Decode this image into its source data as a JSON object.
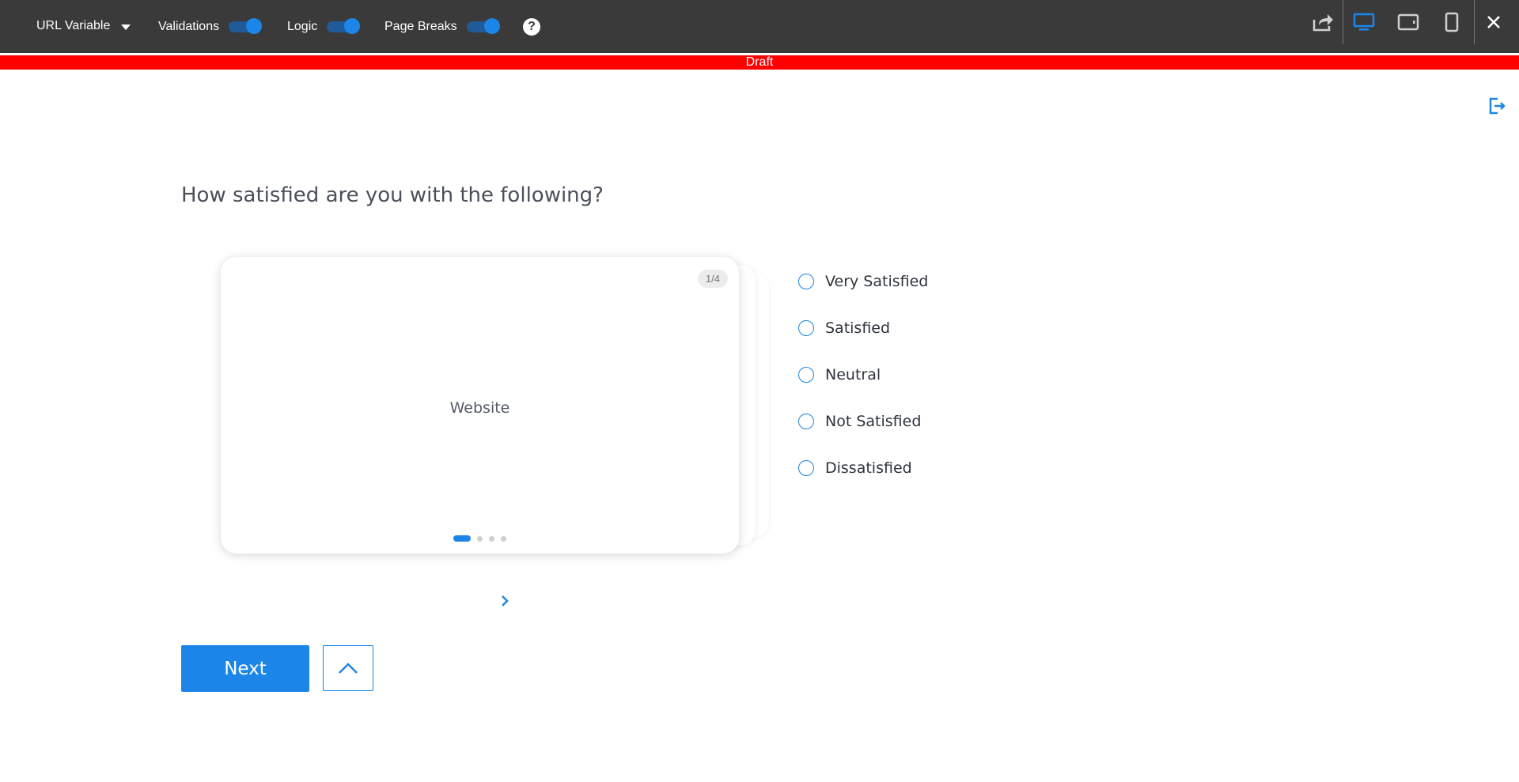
{
  "toolbar": {
    "url_variable_label": "URL Variable",
    "toggles": [
      {
        "label": "Validations",
        "on": true
      },
      {
        "label": "Logic",
        "on": true
      },
      {
        "label": "Page Breaks",
        "on": true
      }
    ],
    "help_label": "?",
    "icons": [
      "share-icon",
      "desktop-view-icon",
      "tablet-view-icon",
      "mobile-view-icon",
      "close-icon"
    ],
    "active_view": "desktop",
    "accent_color": "#1c86e8"
  },
  "banner": {
    "label": "Draft",
    "color": "#ff0000"
  },
  "question": {
    "title": "How satisfied are you with the following?",
    "card": {
      "counter": "1/4",
      "text": "Website",
      "total_items": 4,
      "current_index": 1
    },
    "options": [
      "Very Satisfied",
      "Satisfied",
      "Neutral",
      "Not Satisfied",
      "Dissatisfied"
    ]
  },
  "navigation": {
    "next_label": "Next"
  }
}
